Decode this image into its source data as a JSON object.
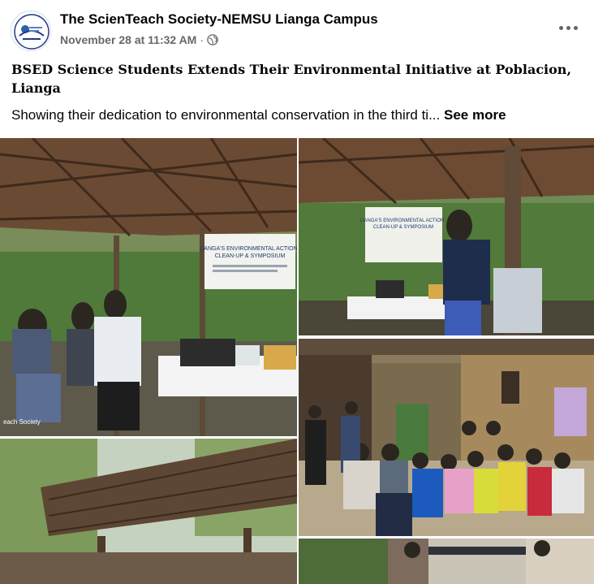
{
  "post": {
    "page_name": "The ScienTeach Society-NEMSU Lianga Campus",
    "timestamp": "November 28 at 11:32 AM",
    "separator": "·",
    "title": "BSED Science Students Extends Their Environmental Initiative at Poblacion, Lianga",
    "body_text": "Showing their dedication to environmental conservation in the third ti...",
    "see_more": "See more"
  },
  "photos": {
    "p1": {
      "banner_title": "LIANGA'S ENVIRONMENTAL ACTION: CLEAN-UP & SYMPOSIUM",
      "watermark": "each Society"
    },
    "p2": {
      "banner_title": "LIANGA'S ENVIRONMENTAL ACTION: CLEAN-UP & SYMPOSIUM"
    }
  },
  "icons": {
    "globe": "globe-icon",
    "more": "more-options-icon"
  },
  "colors": {
    "meta_gray": "#65676b",
    "text": "#050505"
  }
}
